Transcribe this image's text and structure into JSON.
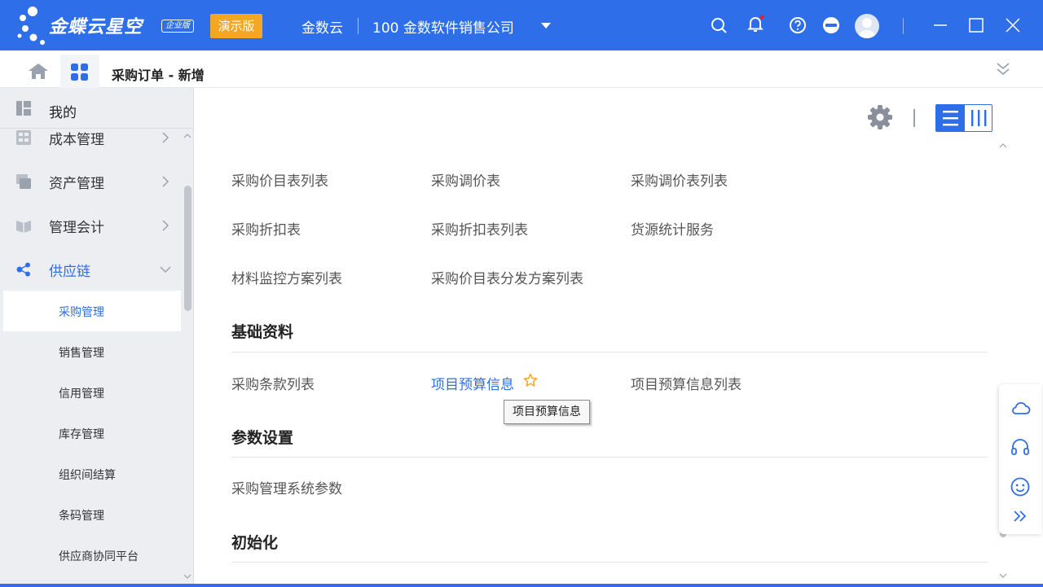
{
  "header": {
    "brand": "金蝶云星空",
    "edition": "企业版",
    "demo_badge": "演示版",
    "org": "金数云",
    "company": "100  金数软件销售公司",
    "icons": [
      "search-icon",
      "bell-icon",
      "help-icon",
      "minus-circle-icon",
      "avatar",
      "minimize-icon",
      "maximize-icon",
      "close-icon"
    ],
    "accent": "#2e6fe9",
    "demo_color": "#f5a623"
  },
  "tabs": {
    "current": "采购订单 - 新增"
  },
  "sidebar": {
    "mine": "我的",
    "items": [
      {
        "label": "成本管理",
        "icon": "cost-icon"
      },
      {
        "label": "资产管理",
        "icon": "asset-icon"
      },
      {
        "label": "管理会计",
        "icon": "accounting-icon"
      },
      {
        "label": "供应链",
        "icon": "supply-chain-icon"
      }
    ],
    "sub_items": [
      {
        "label": "采购管理",
        "active": true
      },
      {
        "label": "销售管理"
      },
      {
        "label": "信用管理"
      },
      {
        "label": "库存管理"
      },
      {
        "label": "组织间结算"
      },
      {
        "label": "条码管理"
      },
      {
        "label": "供应商协同平台"
      }
    ]
  },
  "main": {
    "rows": [
      [
        "采购价目表列表",
        "采购调价表",
        "采购调价表列表"
      ],
      [
        "采购折扣表",
        "采购折扣表列表",
        "货源统计服务"
      ],
      [
        "材料监控方案列表",
        "采购价目表分发方案列表"
      ]
    ],
    "sections": [
      {
        "title": "基础资料",
        "links": [
          "采购条款列表",
          "项目预算信息",
          "项目预算信息列表"
        ]
      },
      {
        "title": "参数设置",
        "links": [
          "采购管理系统参数"
        ]
      },
      {
        "title": "初始化",
        "links": []
      }
    ],
    "tooltip": "项目预算信息"
  }
}
